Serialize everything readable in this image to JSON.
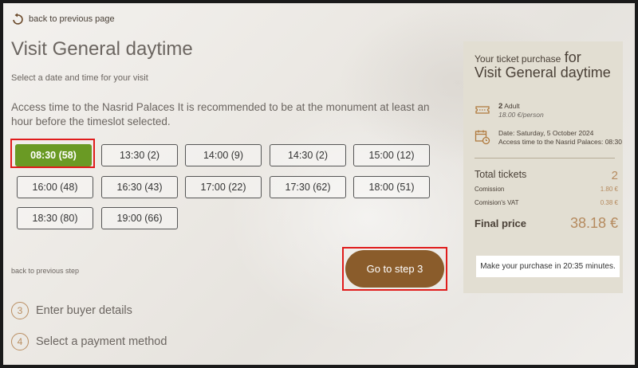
{
  "nav": {
    "back_page": "back to previous page",
    "back_step": "back to previous step"
  },
  "page": {
    "title": "Visit General daytime",
    "subtitle": "Select a date and time for your visit",
    "access_text": "Access time to the Nasrid Palaces It is recommended to be at the monument at least an hour before the timeslot selected."
  },
  "slots": [
    {
      "label": "08:30 (58)",
      "selected": true
    },
    {
      "label": "13:30 (2)"
    },
    {
      "label": "14:00 (9)"
    },
    {
      "label": "14:30 (2)"
    },
    {
      "label": "15:00 (12)"
    },
    {
      "label": "16:00 (48)"
    },
    {
      "label": "16:30 (43)"
    },
    {
      "label": "17:00 (22)"
    },
    {
      "label": "17:30 (62)"
    },
    {
      "label": "18:00 (51)"
    },
    {
      "label": "18:30 (80)"
    },
    {
      "label": "19:00 (66)"
    }
  ],
  "next_button": "Go to step 3",
  "steps": [
    {
      "num": "3",
      "label": "Enter buyer details"
    },
    {
      "num": "4",
      "label": "Select a payment method"
    }
  ],
  "summary": {
    "heading_small": "Your ticket purchase",
    "heading_big_for": "for",
    "heading_big_name": "Visit General daytime",
    "ticket_qty": "2",
    "ticket_type": "Adult",
    "ticket_price": "18.00 €/person",
    "date_line": "Date: Saturday, 5 October 2024",
    "access_line": "Access time to the Nasrid Palaces: 08:30",
    "total_tickets_label": "Total tickets",
    "total_tickets_value": "2",
    "commission_label": "Comission",
    "commission_value": "1.80 €",
    "vat_label": "Comision's VAT",
    "vat_value": "0.38 €",
    "final_label": "Final price",
    "final_value": "38.18 €",
    "timer_text": "Make your purchase in 20:35 minutes."
  },
  "icons": {
    "back": "back-arrow-icon",
    "ticket": "ticket-icon",
    "calendar": "calendar-clock-icon"
  },
  "colors": {
    "selected_slot": "#6a9a24",
    "primary_button": "#8a5c2b",
    "highlight": "#e01c1c",
    "accent": "#b58a5e"
  }
}
